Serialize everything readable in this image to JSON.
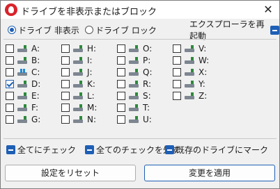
{
  "window": {
    "title": "ドライブを非表示またはブロック",
    "close_label": "✕"
  },
  "modes": [
    {
      "label": "ドライブ 非表示",
      "selected": true
    },
    {
      "label": "ドライブ ロック",
      "selected": false
    }
  ],
  "restart_label": "エクスプローラを再起動",
  "drives": [
    {
      "letter": "A:",
      "checked": false,
      "icon": "hard-drive-icon"
    },
    {
      "letter": "B:",
      "checked": false,
      "icon": "hard-drive-icon"
    },
    {
      "letter": "C:",
      "checked": false,
      "icon": "windows-drive-icon"
    },
    {
      "letter": "D:",
      "checked": true,
      "icon": "hard-drive-icon"
    },
    {
      "letter": "E:",
      "checked": false,
      "icon": "hard-drive-icon"
    },
    {
      "letter": "F:",
      "checked": false,
      "icon": "hard-drive-icon"
    },
    {
      "letter": "G:",
      "checked": false,
      "icon": "hard-drive-icon"
    },
    {
      "letter": "H:",
      "checked": false,
      "icon": "hard-drive-icon"
    },
    {
      "letter": "I:",
      "checked": false,
      "icon": "hard-drive-icon"
    },
    {
      "letter": "J:",
      "checked": false,
      "icon": "hard-drive-icon"
    },
    {
      "letter": "K:",
      "checked": false,
      "icon": "hard-drive-icon"
    },
    {
      "letter": "L:",
      "checked": false,
      "icon": "hard-drive-icon"
    },
    {
      "letter": "M:",
      "checked": false,
      "icon": "hard-drive-icon"
    },
    {
      "letter": "N:",
      "checked": false,
      "icon": "hard-drive-icon"
    },
    {
      "letter": "O:",
      "checked": false,
      "icon": "hard-drive-icon"
    },
    {
      "letter": "P:",
      "checked": false,
      "icon": "hard-drive-icon"
    },
    {
      "letter": "Q:",
      "checked": false,
      "icon": "hard-drive-icon"
    },
    {
      "letter": "R:",
      "checked": false,
      "icon": "hard-drive-icon"
    },
    {
      "letter": "S:",
      "checked": false,
      "icon": "hard-drive-icon"
    },
    {
      "letter": "T:",
      "checked": false,
      "icon": "hard-drive-icon"
    },
    {
      "letter": "U:",
      "checked": false,
      "icon": "hard-drive-icon"
    },
    {
      "letter": "V:",
      "checked": false,
      "icon": "hard-drive-icon"
    },
    {
      "letter": "W:",
      "checked": false,
      "icon": "hard-drive-icon"
    },
    {
      "letter": "X:",
      "checked": false,
      "icon": "hard-drive-icon"
    },
    {
      "letter": "Y:",
      "checked": false,
      "icon": "hard-drive-icon"
    },
    {
      "letter": "Z:",
      "checked": false,
      "icon": "hard-drive-icon"
    }
  ],
  "actions": {
    "check_all": "全てにチェック",
    "uncheck_all": "全てのチェックを外す",
    "mark_existing": "既存のドライブにマーク"
  },
  "buttons": {
    "reset": "設定をリセット",
    "apply": "変更を適用"
  },
  "colors": {
    "accent": "#1e5fb5",
    "app_icon": "#d9232a"
  }
}
